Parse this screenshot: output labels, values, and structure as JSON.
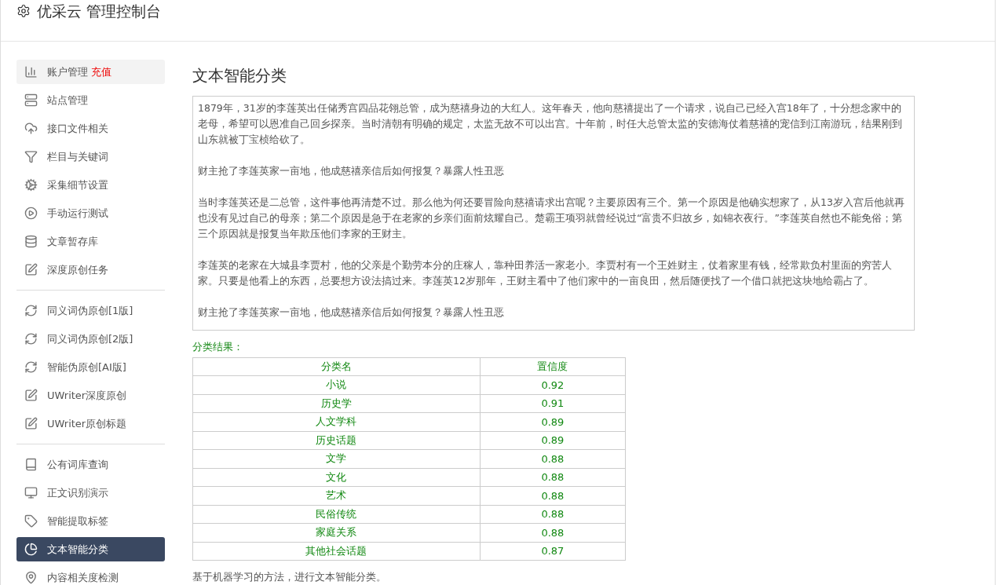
{
  "header": {
    "title": "优采云 管理控制台"
  },
  "sidebar": {
    "groups": [
      {
        "items": [
          {
            "label": "账户管理",
            "badge": "充值",
            "hovered": true,
            "selected": false
          },
          {
            "label": "站点管理",
            "hovered": false,
            "selected": false
          },
          {
            "label": "接口文件相关",
            "hovered": false,
            "selected": false
          },
          {
            "label": "栏目与关键词",
            "hovered": false,
            "selected": false
          },
          {
            "label": "采集细节设置",
            "hovered": false,
            "selected": false
          },
          {
            "label": "手动运行测试",
            "hovered": false,
            "selected": false
          },
          {
            "label": "文章暂存库",
            "hovered": false,
            "selected": false
          },
          {
            "label": "深度原创任务",
            "hovered": false,
            "selected": false
          }
        ]
      },
      {
        "items": [
          {
            "label": "同义词伪原创[1版]",
            "hovered": false,
            "selected": false
          },
          {
            "label": "同义词伪原创[2版]",
            "hovered": false,
            "selected": false
          },
          {
            "label": "智能伪原创[AI版]",
            "hovered": false,
            "selected": false
          },
          {
            "label": "UWriter深度原创",
            "hovered": false,
            "selected": false
          },
          {
            "label": "UWriter原创标题",
            "hovered": false,
            "selected": false
          }
        ]
      },
      {
        "items": [
          {
            "label": "公有词库查询",
            "hovered": false,
            "selected": false
          },
          {
            "label": "正文识别演示",
            "hovered": false,
            "selected": false
          },
          {
            "label": "智能提取标签",
            "hovered": false,
            "selected": false
          },
          {
            "label": "文本智能分类",
            "hovered": false,
            "selected": true
          },
          {
            "label": "内容相关度检测",
            "hovered": false,
            "selected": false
          }
        ]
      }
    ]
  },
  "main": {
    "title": "文本智能分类",
    "input_text": [
      "1879年，31岁的李莲英出任储秀宫四品花翎总管，成为慈禧身边的大红人。这年春天，他向慈禧提出了一个请求，说自己已经入宫18年了，十分想念家中的老母，希望可以恩准自己回乡探亲。当时清朝有明确的规定，太监无故不可以出宫。十年前，时任大总管太监的安德海仗着慈禧的宠信到江南游玩，结果刚到山东就被丁宝桢给砍了。",
      "财主抢了李莲英家一亩地，他成慈禧亲信后如何报复？暴露人性丑恶",
      "当时李莲英还是二总管，这件事他再清楚不过。那么他为何还要冒险向慈禧请求出宫呢？主要原因有三个。第一个原因是他确实想家了，从13岁入宫后他就再也没有见过自己的母亲；第二个原因是急于在老家的乡亲们面前炫耀自己。楚霸王项羽就曾经说过“富贵不归故乡，如锦衣夜行。”李莲英自然也不能免俗；第三个原因就是报复当年欺压他们李家的王财主。",
      "李莲英的老家在大城县李贾村，他的父亲是个勤劳本分的庄稼人，靠种田养活一家老小。李贾村有一个王姓财主，仗着家里有钱，经常欺负村里面的穷苦人家。只要是他看上的东西，总要想方设法搞过来。李莲英12岁那年，王财主看中了他们家中的一亩良田，然后随便找了一个借口就把这块地给霸占了。",
      "财主抢了李莲英家一亩地，他成慈禧亲信后如何报复？暴露人性丑恶"
    ],
    "result_title": "分类结果：",
    "table": {
      "columns": [
        "分类名",
        "置信度"
      ],
      "rows": [
        [
          "小说",
          "0.92"
        ],
        [
          "历史学",
          "0.91"
        ],
        [
          "人文学科",
          "0.89"
        ],
        [
          "历史话题",
          "0.89"
        ],
        [
          "文学",
          "0.88"
        ],
        [
          "文化",
          "0.88"
        ],
        [
          "艺术",
          "0.88"
        ],
        [
          "民俗传统",
          "0.88"
        ],
        [
          "家庭关系",
          "0.88"
        ],
        [
          "其他社会话题",
          "0.87"
        ]
      ]
    },
    "footnote": "基于机器学习的方法，进行文本智能分类。"
  }
}
